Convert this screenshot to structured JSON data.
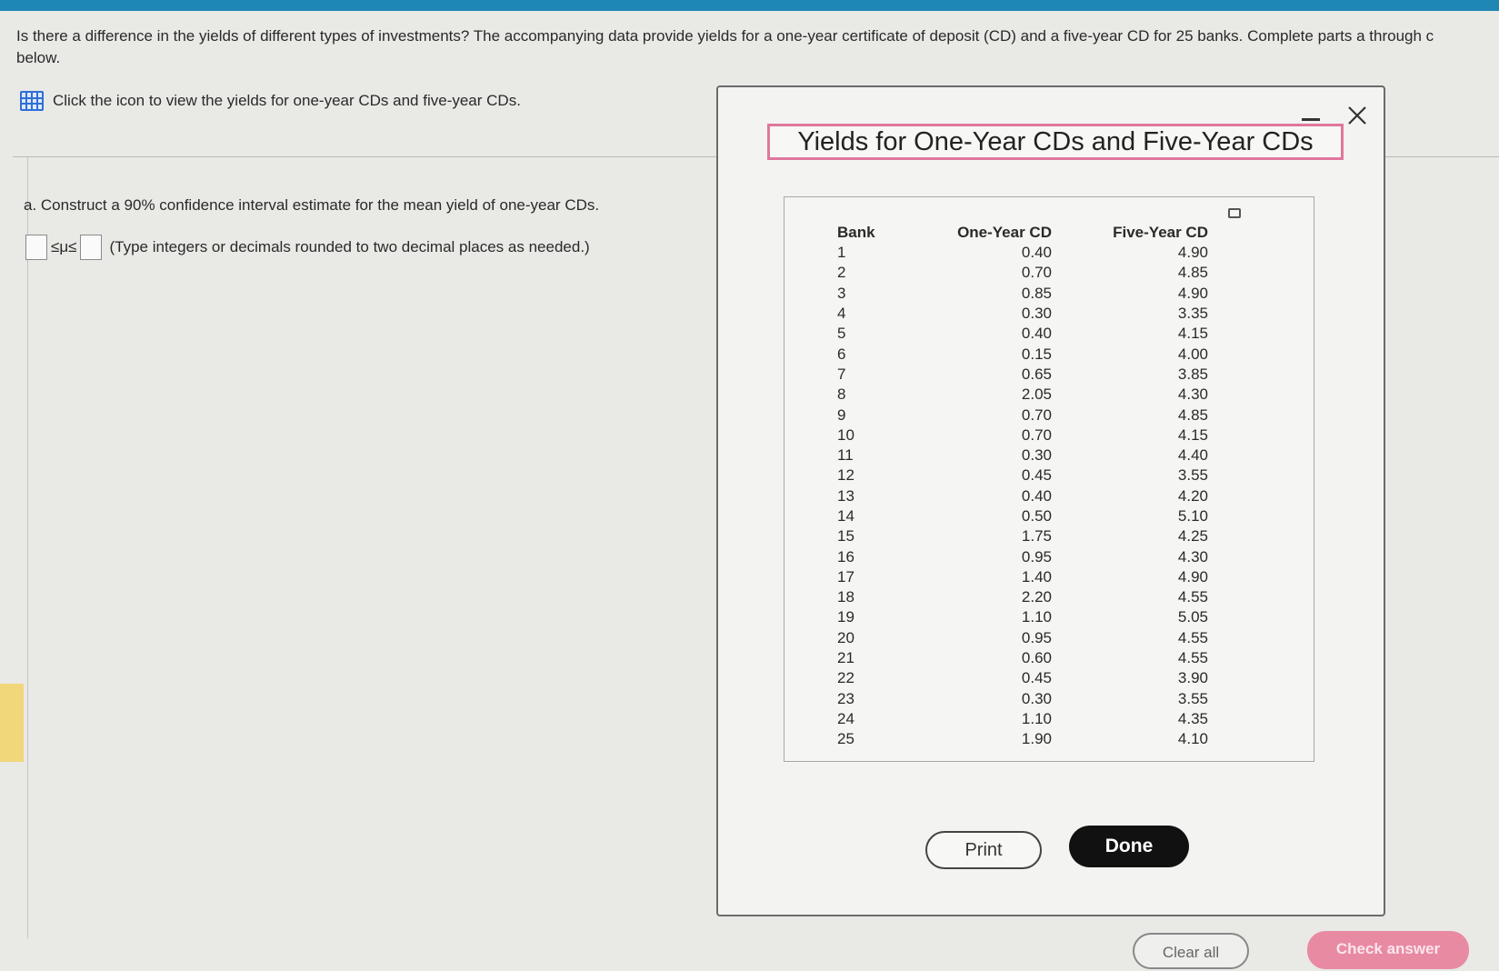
{
  "question": {
    "text": "Is there a difference in the yields of different types of investments? The accompanying data provide yields for a one-year certificate of deposit (CD) and a five-year CD for 25 banks. Complete parts a through c below.",
    "click_text": "Click the icon to view the yields for one-year CDs and five-year CDs.",
    "grid_icon": "table-grid-icon"
  },
  "part_a": {
    "text": "a. Construct a 90% confidence interval estimate for the mean yield of one-year CDs.",
    "inequality": "≤μ≤",
    "hint": "(Type integers or decimals rounded to two decimal places as needed.)"
  },
  "modal": {
    "title": "Yields for One-Year CDs and Five-Year CDs",
    "headers": {
      "bank": "Bank",
      "one_year": "One-Year CD",
      "five_year": "Five-Year CD"
    },
    "rows": [
      {
        "bank": "1",
        "one": "0.40",
        "five": "4.90"
      },
      {
        "bank": "2",
        "one": "0.70",
        "five": "4.85"
      },
      {
        "bank": "3",
        "one": "0.85",
        "five": "4.90"
      },
      {
        "bank": "4",
        "one": "0.30",
        "five": "3.35"
      },
      {
        "bank": "5",
        "one": "0.40",
        "five": "4.15"
      },
      {
        "bank": "6",
        "one": "0.15",
        "five": "4.00"
      },
      {
        "bank": "7",
        "one": "0.65",
        "five": "3.85"
      },
      {
        "bank": "8",
        "one": "2.05",
        "five": "4.30"
      },
      {
        "bank": "9",
        "one": "0.70",
        "five": "4.85"
      },
      {
        "bank": "10",
        "one": "0.70",
        "five": "4.15"
      },
      {
        "bank": "11",
        "one": "0.30",
        "five": "4.40"
      },
      {
        "bank": "12",
        "one": "0.45",
        "five": "3.55"
      },
      {
        "bank": "13",
        "one": "0.40",
        "five": "4.20"
      },
      {
        "bank": "14",
        "one": "0.50",
        "five": "5.10"
      },
      {
        "bank": "15",
        "one": "1.75",
        "five": "4.25"
      },
      {
        "bank": "16",
        "one": "0.95",
        "five": "4.30"
      },
      {
        "bank": "17",
        "one": "1.40",
        "five": "4.90"
      },
      {
        "bank": "18",
        "one": "2.20",
        "five": "4.55"
      },
      {
        "bank": "19",
        "one": "1.10",
        "five": "5.05"
      },
      {
        "bank": "20",
        "one": "0.95",
        "five": "4.55"
      },
      {
        "bank": "21",
        "one": "0.60",
        "five": "4.55"
      },
      {
        "bank": "22",
        "one": "0.45",
        "five": "3.90"
      },
      {
        "bank": "23",
        "one": "0.30",
        "five": "3.55"
      },
      {
        "bank": "24",
        "one": "1.10",
        "five": "4.35"
      },
      {
        "bank": "25",
        "one": "1.90",
        "five": "4.10"
      }
    ],
    "print_label": "Print",
    "done_label": "Done"
  },
  "footer": {
    "clear_label": "Clear all",
    "check_label": "Check answer"
  },
  "colors": {
    "topbar": "#1f87b4",
    "title_border": "#e0779d",
    "check_button": "#e98aa3"
  }
}
